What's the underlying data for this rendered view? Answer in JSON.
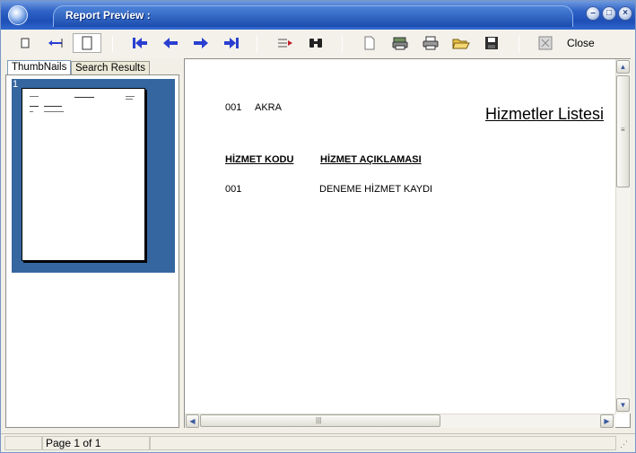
{
  "window": {
    "title": "Report Preview :"
  },
  "toolbar": {
    "close_label": "Close"
  },
  "tabs": [
    {
      "label": "ThumbNails"
    },
    {
      "label": "Search Results"
    }
  ],
  "thumbnail": {
    "page_number": "1"
  },
  "report": {
    "company_code": "001",
    "company_name": "AKRA",
    "title": "Hizmetler Listesi",
    "columns": [
      "HİZMET KODU",
      "HİZMET AÇIKLAMASI"
    ],
    "rows": [
      {
        "code": "001",
        "description": "DENEME HİZMET KAYDI"
      }
    ]
  },
  "status": {
    "page_info": "Page 1 of 1"
  }
}
